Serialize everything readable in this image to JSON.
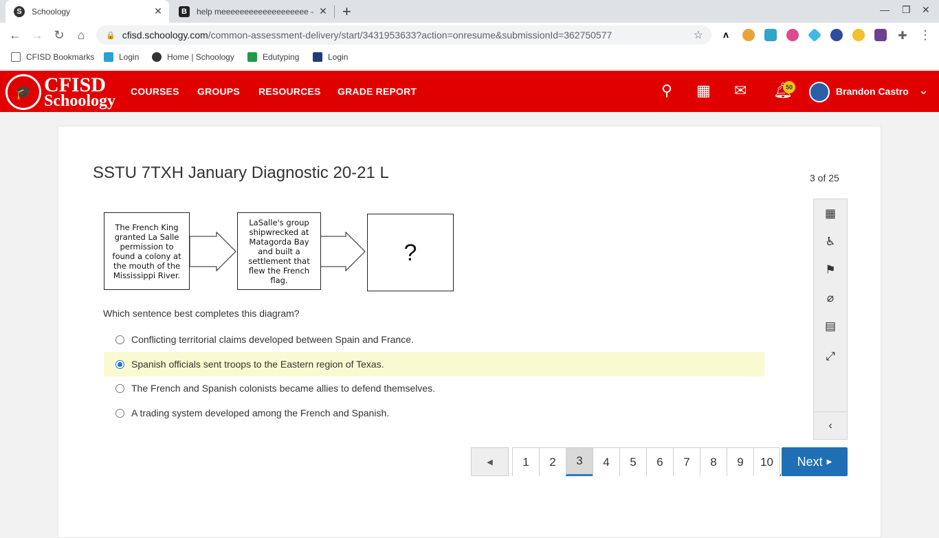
{
  "browser": {
    "tabs": [
      {
        "favicon": "S",
        "title": "Schoology",
        "active": true
      },
      {
        "favicon": "B",
        "title": "help meeeeeeeeeeeeeeeeeee - B",
        "active": false
      }
    ],
    "url_host": "cfisd.schoology.com",
    "url_path": "/common-assessment-delivery/start/3431953633?action=onresume&submissionId=362750577",
    "bookmarks": [
      "CFISD Bookmarks",
      "Login",
      "Home | Schoology",
      "Edutyping",
      "Login"
    ]
  },
  "header": {
    "logo_line1": "CFISD",
    "logo_line2": "Schoology",
    "nav": [
      "COURSES",
      "GROUPS",
      "RESOURCES",
      "GRADE REPORT"
    ],
    "notification_count": "50",
    "user_name": "Brandon Castro",
    "accent_color": "#e10000"
  },
  "assessment": {
    "title": "SSTU 7TXH January Diagnostic 20-21 L",
    "question_counter": "3 of 25",
    "diagram": {
      "box1": "The French King granted La Salle permission to found a colony at the mouth of the Mississippi River.",
      "box2": "LaSalle's group shipwrecked at Matagorda Bay and built a settlement that flew the French flag.",
      "box3": "?"
    },
    "prompt": "Which sentence best completes this diagram?",
    "choices": [
      "Conflicting territorial claims developed between Spain and France.",
      "Spanish officials sent troops to the Eastern region of Texas.",
      "The French and Spanish colonists became allies to defend themselves.",
      "A trading system developed among the French and Spanish."
    ],
    "selected_choice_index": 1
  },
  "pager": {
    "pages": [
      "1",
      "2",
      "3",
      "4",
      "5",
      "6",
      "7",
      "8",
      "9",
      "10"
    ],
    "current_page": "3",
    "next_label": "Next"
  }
}
